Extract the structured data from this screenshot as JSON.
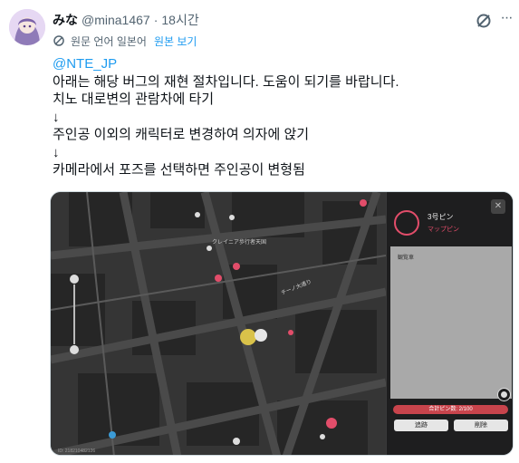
{
  "tweet": {
    "author_name": "みな",
    "author_handle": "@mina1467",
    "separator": "·",
    "time": "18시간",
    "translation_note": "원문 언어 일본어",
    "show_original": "원본 보기",
    "lines": [
      "@NTE_JP",
      "아래는 해당 버그의 재현 절차입니다. 도움이 되기를 바랍니다.",
      "치노 대로변의 관람차에 타기",
      "↓",
      "주인공 이외의 캐릭터로 변경하여 의자에 앉기",
      "↓",
      "카메라에서 포즈를 선택하면 주인공이 변형됨"
    ]
  },
  "media": {
    "map_labels": {
      "district": "クレイニア歩行者天国",
      "street": "チーノ大通り",
      "coords": "ID: 218210482126"
    },
    "panel": {
      "title": "3号ピン",
      "subtitle": "マップピン",
      "body_label": "観覧車",
      "count": "合計ピン数: 2/100",
      "track_button": "追跡",
      "delete_button": "削除",
      "close": "✕"
    }
  },
  "colors": {
    "link": "#1d9bf0",
    "muted": "#536471",
    "text": "#0f1419",
    "accent_pink": "#e24d6a"
  },
  "icons": [
    "grok-icon",
    "more-icon",
    "translate-icon",
    "gear-icon",
    "close-icon"
  ]
}
